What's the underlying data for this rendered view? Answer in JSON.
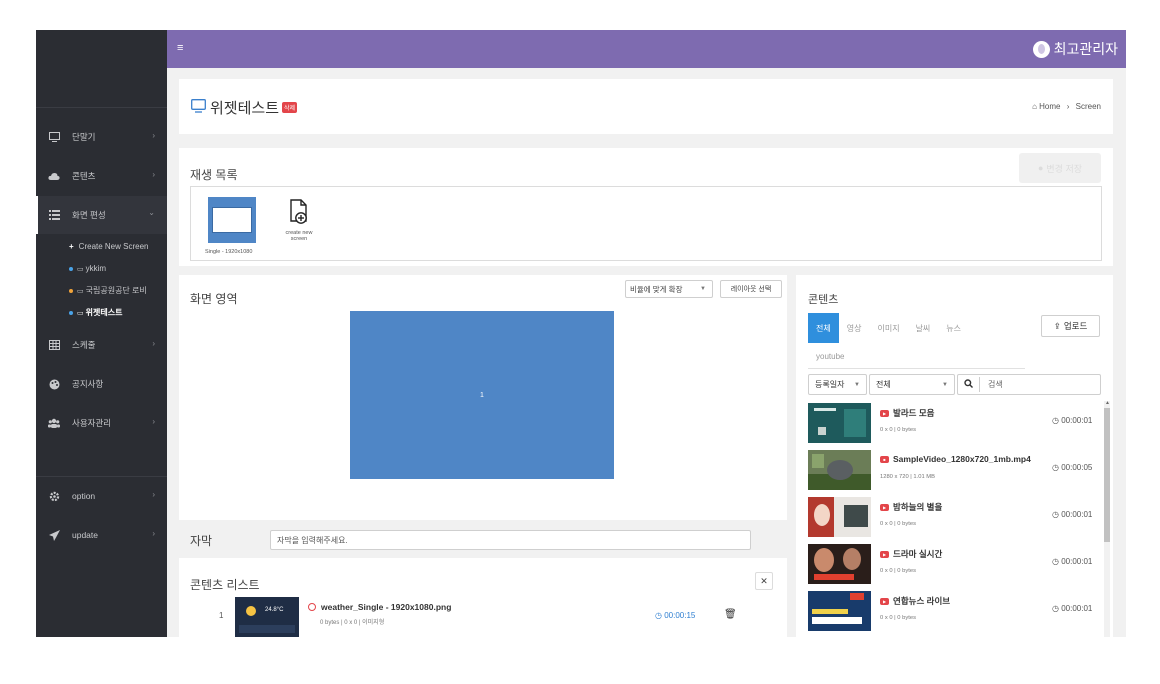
{
  "topbar": {
    "menu_icon": "≡",
    "user_name": "최고관리자"
  },
  "sidebar": {
    "items": [
      {
        "label": "단말기",
        "icon": "monitor-icon",
        "chevron": "›"
      },
      {
        "label": "콘텐츠",
        "icon": "cloud-icon",
        "chevron": "›"
      },
      {
        "label": "화면 편성",
        "icon": "list-icon",
        "chevron": "⌄"
      },
      {
        "label": "스케줄",
        "icon": "grid-icon",
        "chevron": "›"
      },
      {
        "label": "공지사항",
        "icon": "palette-icon",
        "chevron": ""
      },
      {
        "label": "사용자관리",
        "icon": "users-icon",
        "chevron": "›"
      },
      {
        "label": "option",
        "icon": "gear-icon",
        "chevron": "›"
      },
      {
        "label": "update",
        "icon": "paper-plane-icon",
        "chevron": "›"
      }
    ],
    "sub_items": [
      {
        "label": "Create New Screen",
        "marker": "+"
      },
      {
        "label": "ykkim",
        "marker_color": "#4aa3e8"
      },
      {
        "label": "국립공원공단 로비",
        "marker_color": "#f0a33a"
      },
      {
        "label": "위젯테스트",
        "marker_color": "#4aa3e8"
      }
    ]
  },
  "page": {
    "title": "위젯테스트",
    "delete_badge": "삭제",
    "breadcrumb_home": "Home",
    "breadcrumb_sep": "›",
    "breadcrumb_current": "Screen"
  },
  "playlist": {
    "title": "재생 목록",
    "save_label": "변경 저장",
    "screen_label": "Single - 1920x1080",
    "new_screen_label_1": "create new",
    "new_screen_label_2": "screen"
  },
  "screen_area": {
    "title": "화면 영역",
    "fit_option": "비율에 맞게 확장",
    "layout_button": "레이아웃 선택",
    "zone_number": "1"
  },
  "caption": {
    "title": "자막",
    "placeholder": "자막을 입력해주세요."
  },
  "content_list": {
    "title": "콘텐츠 리스트",
    "rows": [
      {
        "index": "1",
        "name": "weather_Single - 1920x1080.png",
        "meta": "0 bytes | 0 x 0 | 이미지형",
        "duration": "00:00:15",
        "thumb_temp": "24.8°C"
      }
    ]
  },
  "contents": {
    "title": "콘텐츠",
    "tabs": [
      "전체",
      "영상",
      "이미지",
      "날씨",
      "뉴스"
    ],
    "youtube_tab": "youtube",
    "upload_label": "업로드",
    "sort_label": "등록일자",
    "type_label": "전체",
    "search_placeholder": "검색",
    "items": [
      {
        "name": "발라드 모음",
        "meta": "0 x 0 | 0 bytes",
        "duration": "00:00:01",
        "kind": "youtube"
      },
      {
        "name": "SampleVideo_1280x720_1mb.mp4",
        "meta": "1280 x 720 | 1.01 MB",
        "duration": "00:00:05",
        "kind": "video"
      },
      {
        "name": "밤하늘의 별을",
        "meta": "0 x 0 | 0 bytes",
        "duration": "00:00:01",
        "kind": "youtube"
      },
      {
        "name": "드라마 실시간",
        "meta": "0 x 0 | 0 bytes",
        "duration": "00:00:01",
        "kind": "youtube"
      },
      {
        "name": "연합뉴스 라이브",
        "meta": "0 x 0 | 0 bytes",
        "duration": "00:00:01",
        "kind": "youtube"
      }
    ]
  },
  "colors": {
    "topbar": "#7e6bb0",
    "sidebar": "#2b2d33",
    "accent_blue": "#2f8fdd",
    "screen_blue": "#4f86c6",
    "youtube_red": "#e3454a"
  }
}
